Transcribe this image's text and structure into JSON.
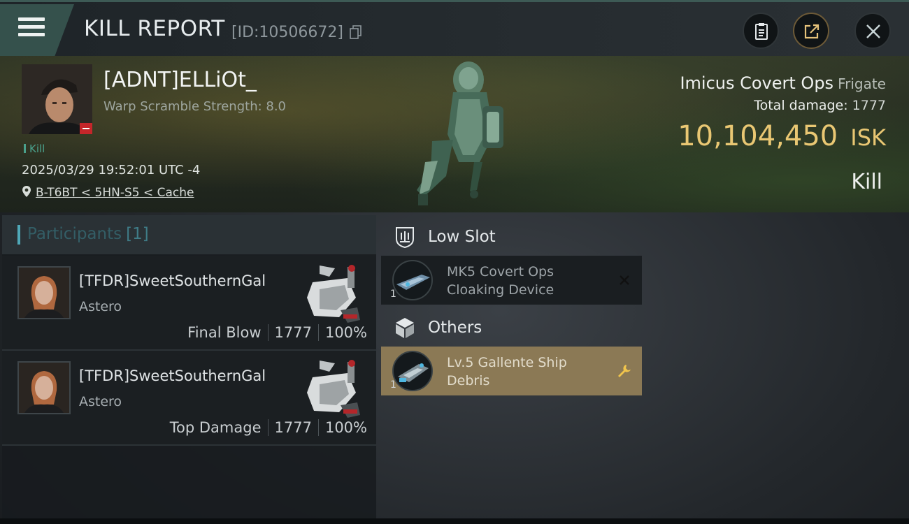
{
  "header": {
    "title": "KILL REPORT",
    "report_id": "[ID:10506672]",
    "icons": [
      "menu-icon",
      "copy-icon",
      "clipboard-icon",
      "share-icon",
      "close-icon"
    ]
  },
  "victim": {
    "name": "[ADNT]ELLiOt_",
    "warp_scramble": "Warp Scramble Strength: 8.0",
    "kill_tag": "Kill",
    "time": "2025/03/29 19:52:01 UTC -4",
    "location": "B-T6BT < 5HN-S5 < Cache",
    "ship_name": "Imicus Covert Ops",
    "ship_class": "Frigate",
    "total_damage_label": "Total damage:",
    "total_damage": "1777",
    "isk_value": "10,104,450",
    "isk_unit": "ISK",
    "result": "Kill"
  },
  "participants": {
    "label": "Participants",
    "count": "[1]",
    "rows": [
      {
        "name": "[TFDR]SweetSouthernGal",
        "ship": "Astero",
        "role": "Final Blow",
        "damage": "1777",
        "percent": "100%"
      },
      {
        "name": "[TFDR]SweetSouthernGal",
        "ship": "Astero",
        "role": "Top Damage",
        "damage": "1777",
        "percent": "100%"
      }
    ]
  },
  "low_slot": {
    "title": "Low Slot",
    "items": [
      {
        "qty": "1",
        "name_line1": "MK5 Covert Ops",
        "name_line2": "Cloaking Device",
        "status": "destroyed"
      }
    ]
  },
  "others": {
    "title": "Others",
    "items": [
      {
        "qty": "1",
        "name_line1": "Lv.5 Gallente Ship",
        "name_line2": "Debris",
        "status": "dropped"
      }
    ]
  },
  "colors": {
    "accent_teal": "#4fa8b8",
    "isk_gold": "#e9c773",
    "dropped_bg": "#8b7955",
    "kill_green": "#4aa08b"
  }
}
